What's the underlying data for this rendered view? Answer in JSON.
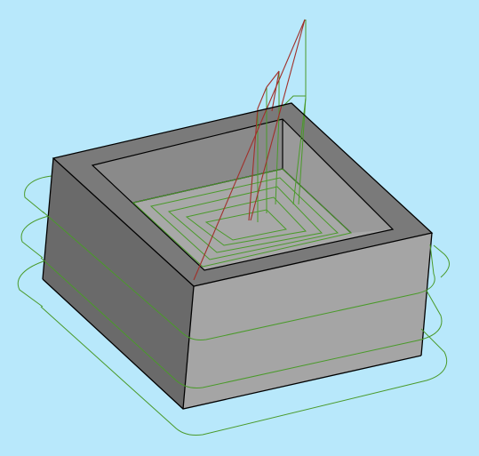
{
  "viewport": {
    "background_color": "#b8e8fb"
  },
  "scene": {
    "object": "rectangular-pocket-block",
    "colors": {
      "top_face": "#7a7a7a",
      "left_face": "#6a6a6a",
      "front_face": "#a5a5a5",
      "pocket_floor": "#a8a8a8",
      "pocket_back_wall": "#8a8a8a",
      "pocket_right_wall": "#9a9a9a",
      "edge_line": "#000000",
      "contour_toolpath": "#4a9a2a",
      "rapid_toolpath": "#a0302a"
    },
    "toolpath_passes": {
      "outer_contour_passes": 3,
      "pocket_contour_passes": 4
    }
  }
}
